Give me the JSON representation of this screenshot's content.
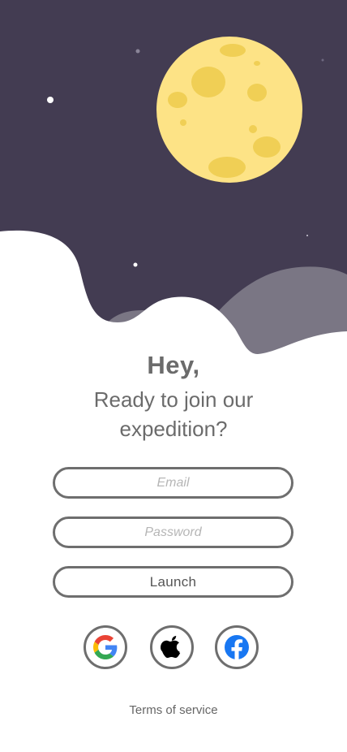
{
  "hero": {
    "description_icons": [
      "moon-icon",
      "star-icon",
      "cloud-icon"
    ]
  },
  "heading": {
    "greeting": "Hey,",
    "subtitle_line1": "Ready to join our",
    "subtitle_line2": "expedition?"
  },
  "form": {
    "email_placeholder": "Email",
    "password_placeholder": "Password",
    "launch_label": "Launch"
  },
  "social": {
    "buttons": [
      {
        "icon": "google-icon"
      },
      {
        "icon": "apple-icon"
      },
      {
        "icon": "facebook-icon"
      }
    ]
  },
  "footer": {
    "terms_label": "Terms of service"
  },
  "colors": {
    "night_sky": "#433c52",
    "moon": "#fde386",
    "moon_crater": "#f0cf55",
    "back_cloud": "#7a7684",
    "front_cloud": "#ffffff",
    "text": "#6b6b6b",
    "border": "#6e6e6e"
  }
}
